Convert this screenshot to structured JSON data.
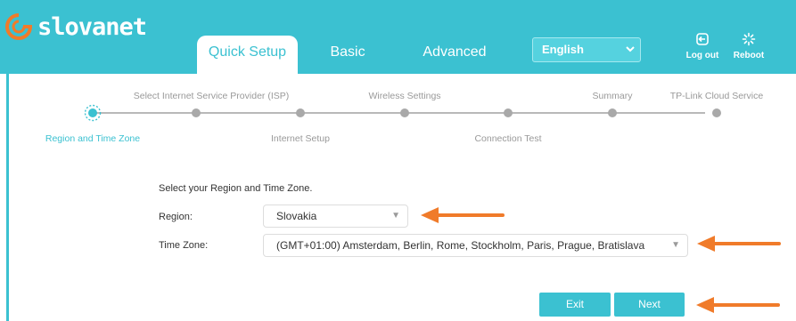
{
  "brand": {
    "name": "slovanet"
  },
  "nav": {
    "tabs": [
      {
        "label": "Quick Setup",
        "active": true
      },
      {
        "label": "Basic",
        "active": false
      },
      {
        "label": "Advanced",
        "active": false
      }
    ],
    "language": "English",
    "logout_label": "Log out",
    "reboot_label": "Reboot"
  },
  "steps": [
    {
      "label": "Region and Time Zone",
      "active": true
    },
    {
      "label": "Select Internet Service Provider (ISP)"
    },
    {
      "label": "Internet Setup"
    },
    {
      "label": "Wireless Settings"
    },
    {
      "label": "Connection Test"
    },
    {
      "label": "Summary"
    },
    {
      "label": "TP-Link Cloud Service"
    }
  ],
  "form": {
    "prompt": "Select your Region and Time Zone.",
    "region_label": "Region:",
    "region_value": "Slovakia",
    "timezone_label": "Time Zone:",
    "timezone_value": "(GMT+01:00) Amsterdam, Berlin, Rome, Stockholm, Paris, Prague, Bratislava"
  },
  "buttons": {
    "exit": "Exit",
    "next": "Next"
  },
  "colors": {
    "accent": "#3bc1d1",
    "annotation_arrow": "#f07b2a",
    "logo_orange": "#f07b2a"
  }
}
